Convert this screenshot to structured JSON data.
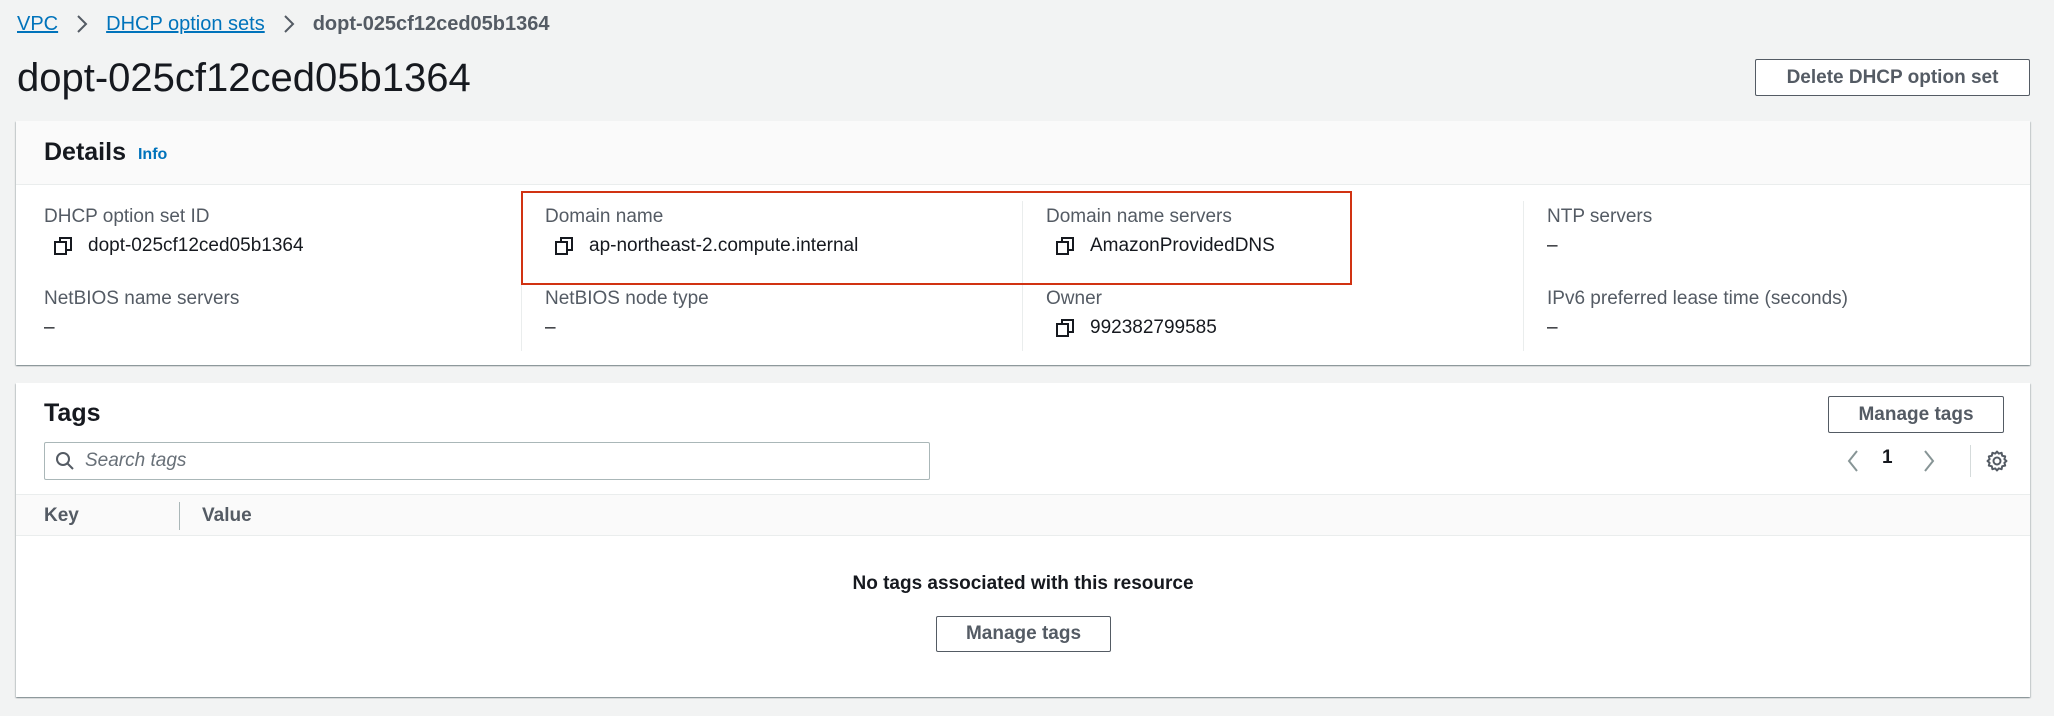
{
  "breadcrumb": {
    "items": [
      "VPC",
      "DHCP option sets"
    ],
    "current": "dopt-025cf12ced05b1364"
  },
  "header": {
    "title": "dopt-025cf12ced05b1364",
    "delete_label": "Delete DHCP option set"
  },
  "details": {
    "title": "Details",
    "info_label": "Info",
    "fields": {
      "option_set_id": {
        "label": "DHCP option set ID",
        "value": "dopt-025cf12ced05b1364"
      },
      "domain_name": {
        "label": "Domain name",
        "value": "ap-northeast-2.compute.internal"
      },
      "domain_name_servers": {
        "label": "Domain name servers",
        "value": "AmazonProvidedDNS"
      },
      "ntp_servers": {
        "label": "NTP servers",
        "value": "–"
      },
      "netbios_name_servers": {
        "label": "NetBIOS name servers",
        "value": "–"
      },
      "netbios_node_type": {
        "label": "NetBIOS node type",
        "value": "–"
      },
      "owner": {
        "label": "Owner",
        "value": "992382799585"
      },
      "ipv6_lease_time": {
        "label": "IPv6 preferred lease time (seconds)",
        "value": "–"
      }
    }
  },
  "tags": {
    "title": "Tags",
    "manage_label": "Manage tags",
    "search_placeholder": "Search tags",
    "page_number": "1",
    "columns": [
      "Key",
      "Value"
    ],
    "empty_message": "No tags associated with this resource",
    "empty_manage_label": "Manage tags"
  },
  "colors": {
    "link": "#0073bb",
    "highlight_border": "#d13212",
    "background": "#f2f3f3"
  }
}
